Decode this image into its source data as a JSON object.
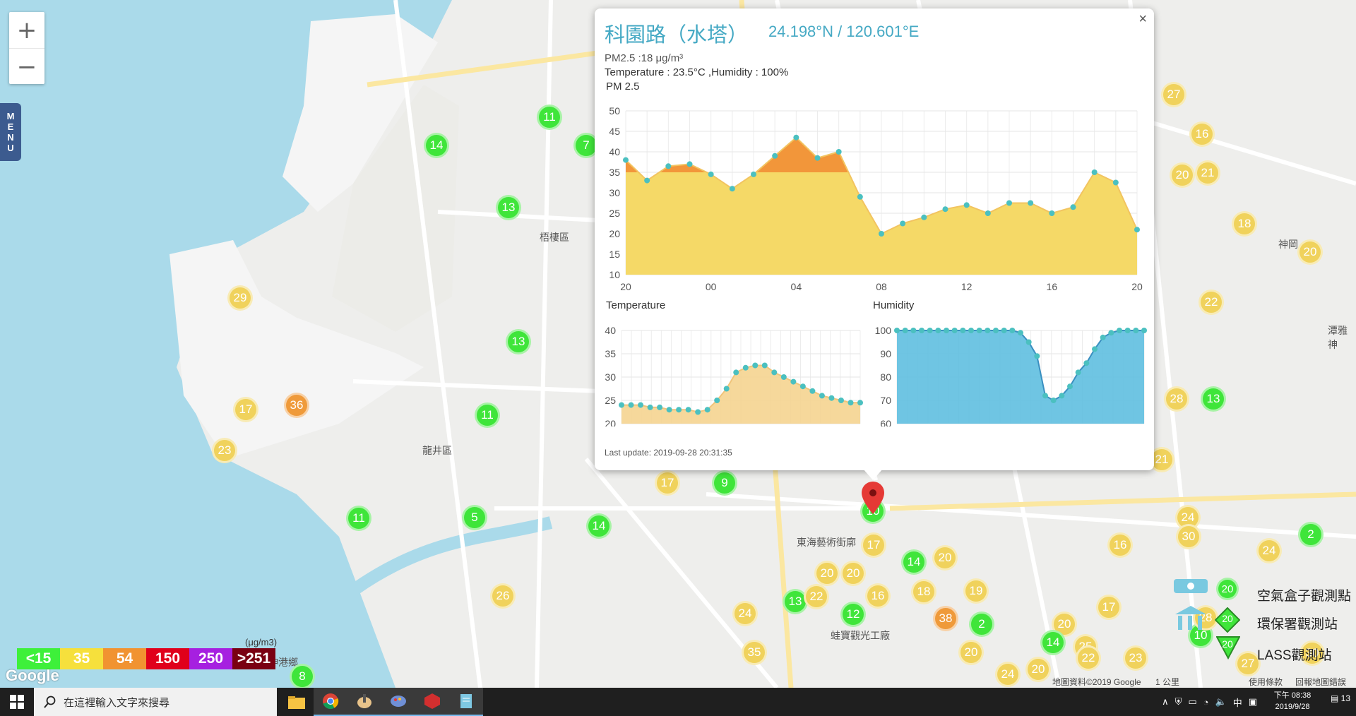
{
  "map": {
    "zoom_in": "+",
    "zoom_out": "−",
    "menu": [
      "M",
      "E",
      "N",
      "U"
    ],
    "area_labels": [
      {
        "id": "wuqi",
        "text": "梧棲區"
      },
      {
        "id": "longjing",
        "text": "龍井區"
      },
      {
        "id": "shenkang",
        "text": "神岡"
      },
      {
        "id": "donghai",
        "text": "東海藝術街廓"
      },
      {
        "id": "fengshan",
        "text": "伸港鄉"
      },
      {
        "id": "guanguang",
        "text": "蛙寶觀光工廠"
      },
      {
        "id": "daya",
        "text": "潭雅神"
      }
    ],
    "markers": [
      {
        "v": "11",
        "c": "g"
      },
      {
        "v": "14",
        "c": "g"
      },
      {
        "v": "7",
        "c": "g"
      },
      {
        "v": "13",
        "c": "g"
      },
      {
        "v": "29",
        "c": "y"
      },
      {
        "v": "13",
        "c": "g"
      },
      {
        "v": "17",
        "c": "y"
      },
      {
        "v": "36",
        "c": "o"
      },
      {
        "v": "23",
        "c": "y"
      },
      {
        "v": "11",
        "c": "g"
      },
      {
        "v": "11",
        "c": "g"
      },
      {
        "v": "5",
        "c": "g"
      },
      {
        "v": "14",
        "c": "g"
      },
      {
        "v": "17",
        "c": "y"
      },
      {
        "v": "9",
        "c": "g"
      },
      {
        "v": "26",
        "c": "y"
      },
      {
        "v": "8",
        "c": "g"
      },
      {
        "v": "24",
        "c": "y"
      },
      {
        "v": "35",
        "c": "y"
      },
      {
        "v": "13",
        "c": "g"
      },
      {
        "v": "22",
        "c": "y"
      },
      {
        "v": "20",
        "c": "y"
      },
      {
        "v": "20",
        "c": "y"
      },
      {
        "v": "12",
        "c": "g"
      },
      {
        "v": "16",
        "c": "y"
      },
      {
        "v": "17",
        "c": "y"
      },
      {
        "v": "14",
        "c": "g"
      },
      {
        "v": "20",
        "c": "y"
      },
      {
        "v": "18",
        "c": "y"
      },
      {
        "v": "38",
        "c": "o"
      },
      {
        "v": "19",
        "c": "y"
      },
      {
        "v": "2",
        "c": "g"
      },
      {
        "v": "20",
        "c": "y"
      },
      {
        "v": "24",
        "c": "y"
      },
      {
        "v": "10",
        "c": "g"
      },
      {
        "v": "27",
        "c": "y"
      },
      {
        "v": "16",
        "c": "y"
      },
      {
        "v": "20",
        "c": "y"
      },
      {
        "v": "21",
        "c": "y"
      },
      {
        "v": "18",
        "c": "y"
      },
      {
        "v": "20",
        "c": "y"
      },
      {
        "v": "22",
        "c": "y"
      },
      {
        "v": "28",
        "c": "y"
      },
      {
        "v": "13",
        "c": "g"
      },
      {
        "v": "21",
        "c": "y"
      },
      {
        "v": "24",
        "c": "y"
      },
      {
        "v": "30",
        "c": "y"
      },
      {
        "v": "16",
        "c": "y"
      },
      {
        "v": "24",
        "c": "y"
      },
      {
        "v": "2",
        "c": "g"
      },
      {
        "v": "20",
        "c": "y"
      },
      {
        "v": "14",
        "c": "g"
      },
      {
        "v": "25",
        "c": "y"
      },
      {
        "v": "22",
        "c": "y"
      },
      {
        "v": "23",
        "c": "y"
      },
      {
        "v": "20",
        "c": "y"
      },
      {
        "v": "10",
        "c": "g"
      },
      {
        "v": "28",
        "c": "y"
      },
      {
        "v": "30",
        "c": "y"
      },
      {
        "v": "27",
        "c": "y"
      },
      {
        "v": "17",
        "c": "y"
      }
    ],
    "scale": {
      "levels": [
        {
          "label": "<15",
          "color": "#3ef03a"
        },
        {
          "label": "35",
          "color": "#f6e03c"
        },
        {
          "label": "54",
          "color": "#f19331"
        },
        {
          "label": "150",
          "color": "#e0001b"
        },
        {
          "label": "250",
          "color": "#a620e0"
        },
        {
          "label": ">251",
          "color": "#7a0012"
        }
      ],
      "unit": "(μg/m3)"
    },
    "google_logo": "Google",
    "legend": [
      {
        "label": "空氣盒子觀測點",
        "badge": "20"
      },
      {
        "label": "環保署觀測站",
        "badge": "20"
      },
      {
        "label": "LASS觀測站",
        "badge": "20"
      }
    ],
    "footer": {
      "map_data": "地圖資料©2019 Google",
      "scale_text": "1 公里",
      "terms": "使用條款",
      "report": "回報地圖錯誤"
    }
  },
  "popup": {
    "close": "×",
    "title": "科園路（水塔）",
    "coords": "24.198°N / 120.601°E",
    "pm25_line": "PM2.5 :18 μg/m³",
    "temp_line": "Temperature : 23.5°C ,Humidity : 100%",
    "pm_label": "PM 2.5",
    "temp_label": "Temperature",
    "hum_label": "Humidity",
    "last_update": "Last update: 2019-09-28 20:31:35"
  },
  "chart_data": [
    {
      "type": "area",
      "title": "PM 2.5",
      "x_tick_labels": [
        "20",
        "00",
        "04",
        "08",
        "12",
        "16",
        "20"
      ],
      "ylim": [
        10,
        50
      ],
      "y_ticks": [
        10,
        15,
        20,
        25,
        30,
        35,
        40,
        45,
        50
      ],
      "threshold": 35,
      "colors": {
        "below": "#f5d967",
        "above": "#f2963a",
        "line": "#f2c460",
        "point": "#4bc0c0"
      },
      "values": [
        38,
        33,
        36.5,
        37,
        34.5,
        31,
        34.5,
        39,
        43.5,
        38.5,
        40,
        29,
        20,
        22.5,
        24,
        26,
        27,
        25,
        27.5,
        27.5,
        25,
        26.5,
        35,
        32.5,
        21
      ]
    },
    {
      "type": "area",
      "title": "Temperature",
      "ylim": [
        20,
        40
      ],
      "y_ticks": [
        20,
        25,
        30,
        35,
        40
      ],
      "colors": {
        "fill": "#f5d490",
        "point": "#4bc0c0"
      },
      "values": [
        24,
        24,
        24,
        23.5,
        23.5,
        23,
        23,
        23,
        22.5,
        23,
        25,
        27.5,
        31,
        32,
        32.5,
        32.5,
        31,
        30,
        29,
        28,
        27,
        26,
        25.5,
        25,
        24.5,
        24.5
      ]
    },
    {
      "type": "area",
      "title": "Humidity",
      "ylim": [
        60,
        100
      ],
      "y_ticks": [
        60,
        70,
        80,
        90,
        100
      ],
      "colors": {
        "fill": "#5fbfe0",
        "point": "#4bc0c0"
      },
      "values": [
        100,
        100,
        100,
        100,
        100,
        100,
        100,
        100,
        100,
        100,
        100,
        100,
        100,
        100,
        100,
        99,
        95,
        89,
        72,
        70,
        72,
        76,
        82,
        86,
        92,
        97,
        99,
        100,
        100,
        100,
        100
      ]
    }
  ],
  "taskbar": {
    "search_placeholder": "在這裡輸入文字來搜尋",
    "tray_ime": "中",
    "time": "下午 08:38",
    "date": "2019/9/28",
    "notif_count": "13"
  }
}
